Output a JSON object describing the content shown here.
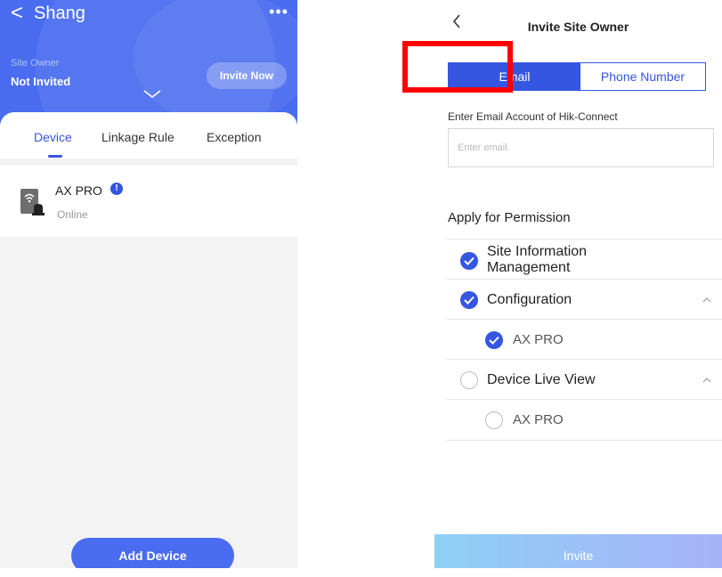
{
  "left": {
    "header": {
      "back_glyph": "<",
      "site_name": "Shang",
      "more_glyph": "•••",
      "owner_label": "Site Owner",
      "owner_status": "Not Invited",
      "invite_now": "Invite Now"
    },
    "tabs": [
      "Device",
      "Linkage Rule",
      "Exception"
    ],
    "active_tab": "Device",
    "devices": [
      {
        "name": "AX PRO",
        "status": "Online",
        "alert": "!"
      }
    ],
    "add_device": "Add Device"
  },
  "right": {
    "title": "Invite Site Owner",
    "segments": {
      "email": "Email",
      "phone": "Phone Number",
      "selected": "Email"
    },
    "email_label": "Enter Email Account of Hik-Connect",
    "email_placeholder": "Enter email.",
    "permission_title": "Apply for Permission",
    "permissions": [
      {
        "label_line1": "Site Information",
        "label_line2": "Management",
        "checked": true
      },
      {
        "label": "Configuration",
        "checked": true,
        "expanded": true
      },
      {
        "label": "AX PRO",
        "checked": true,
        "child": true
      },
      {
        "label": "Device Live View",
        "checked": false,
        "expanded": true
      },
      {
        "label": "AX PRO",
        "checked": false,
        "child": true
      }
    ],
    "invite": "Invite"
  },
  "colors": {
    "accent": "#3556e0",
    "header_bg": "#4a6cf0",
    "annotation": "#ff0000"
  }
}
